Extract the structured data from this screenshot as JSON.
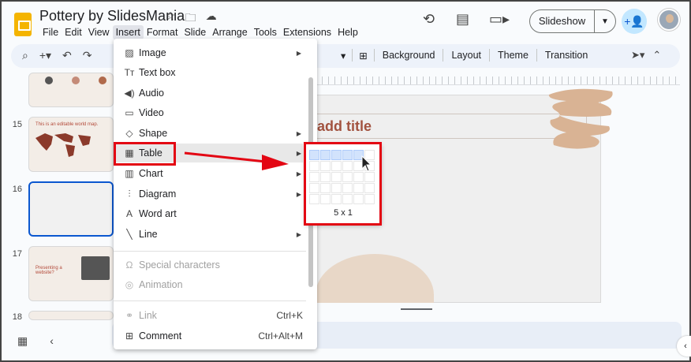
{
  "app": {
    "doc_title": "Pottery by SlidesMania",
    "menus": [
      "File",
      "Edit",
      "View",
      "Insert",
      "Format",
      "Slide",
      "Arrange",
      "Tools",
      "Extensions",
      "Help"
    ],
    "active_menu": "Insert",
    "slideshow_label": "Slideshow"
  },
  "toolbar": {
    "buttons": [
      "Background",
      "Layout",
      "Theme",
      "Transition"
    ]
  },
  "filmstrip": {
    "slides": [
      {
        "number": "15",
        "title": "This is an editable world map."
      },
      {
        "number": "16",
        "title": ""
      },
      {
        "number": "17",
        "title": "Presenting a website?"
      },
      {
        "number": "18",
        "title": ""
      }
    ]
  },
  "canvas": {
    "placeholder_title": "add title"
  },
  "insert_menu": {
    "items": [
      {
        "label": "Image",
        "icon": "image-icon",
        "submenu": true,
        "disabled": false
      },
      {
        "label": "Text box",
        "icon": "text-box-icon",
        "submenu": false,
        "disabled": false
      },
      {
        "label": "Audio",
        "icon": "audio-icon",
        "submenu": false,
        "disabled": false
      },
      {
        "label": "Video",
        "icon": "video-icon",
        "submenu": false,
        "disabled": false
      },
      {
        "label": "Shape",
        "icon": "shape-icon",
        "submenu": true,
        "disabled": false
      },
      {
        "label": "Table",
        "icon": "table-icon",
        "submenu": true,
        "disabled": false,
        "highlighted": true
      },
      {
        "label": "Chart",
        "icon": "chart-icon",
        "submenu": true,
        "disabled": false
      },
      {
        "label": "Diagram",
        "icon": "diagram-icon",
        "submenu": true,
        "disabled": false
      },
      {
        "label": "Word art",
        "icon": "word-art-icon",
        "submenu": false,
        "disabled": false
      },
      {
        "label": "Line",
        "icon": "line-icon",
        "submenu": true,
        "disabled": false
      },
      {
        "label": "Special characters",
        "icon": "omega-icon",
        "submenu": false,
        "disabled": true
      },
      {
        "label": "Animation",
        "icon": "animation-icon",
        "submenu": false,
        "disabled": true
      },
      {
        "label": "Link",
        "icon": "link-icon",
        "submenu": false,
        "disabled": true,
        "shortcut": "Ctrl+K"
      },
      {
        "label": "Comment",
        "icon": "comment-icon",
        "submenu": false,
        "disabled": false,
        "shortcut": "Ctrl+Alt+M"
      }
    ]
  },
  "table_grid": {
    "columns_shown": 6,
    "rows_shown": 5,
    "selected_columns": 5,
    "selected_rows": 1,
    "size_label": "5 x 1"
  },
  "colors": {
    "accent_blue": "#0b57d0",
    "annotation_red": "#e30613",
    "title_brown": "#a2523f"
  }
}
